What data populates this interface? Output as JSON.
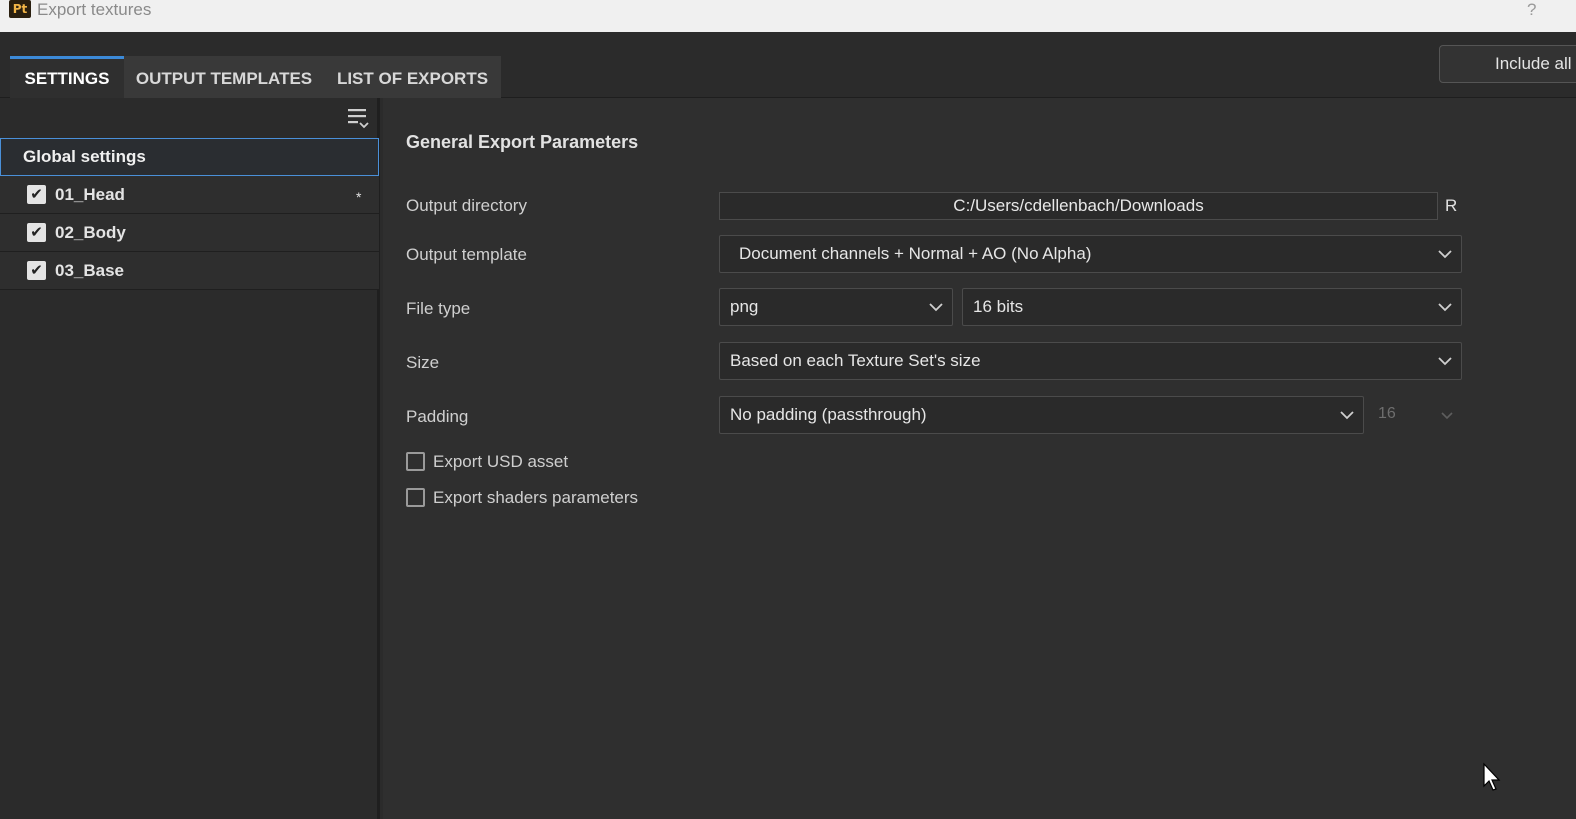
{
  "window": {
    "app_icon_text": "Pt",
    "title": "Export textures",
    "help": "?"
  },
  "tabs": [
    {
      "label": "SETTINGS",
      "active": true
    },
    {
      "label": "OUTPUT TEMPLATES",
      "active": false
    },
    {
      "label": "LIST OF EXPORTS",
      "active": false
    }
  ],
  "include_button": "Include all",
  "sidebar": {
    "global_label": "Global settings",
    "texture_sets": [
      {
        "label": "01_Head",
        "checked": true,
        "modified_marker": "*"
      },
      {
        "label": "02_Body",
        "checked": true,
        "modified_marker": ""
      },
      {
        "label": "03_Base",
        "checked": true,
        "modified_marker": ""
      }
    ],
    "check_glyph": "✔"
  },
  "main": {
    "section_title": "General Export Parameters",
    "output_directory": {
      "label": "Output directory",
      "value": "C:/Users/cdellenbach/Downloads",
      "reset": "R"
    },
    "output_template": {
      "label": "Output template",
      "value": "Document channels + Normal + AO (No Alpha)"
    },
    "file_type": {
      "label": "File type",
      "format": "png",
      "bit_depth": "16 bits"
    },
    "size": {
      "label": "Size",
      "value": "Based on each Texture Set's size"
    },
    "padding": {
      "label": "Padding",
      "value": "No padding (passthrough)",
      "dilation": "16"
    },
    "export_usd": {
      "label": "Export USD asset",
      "checked": false
    },
    "export_shaders": {
      "label": "Export shaders parameters",
      "checked": false
    }
  },
  "colors": {
    "accent": "#3c8ad8",
    "background": "#2b2b2b",
    "panel": "#2f2f2f"
  }
}
